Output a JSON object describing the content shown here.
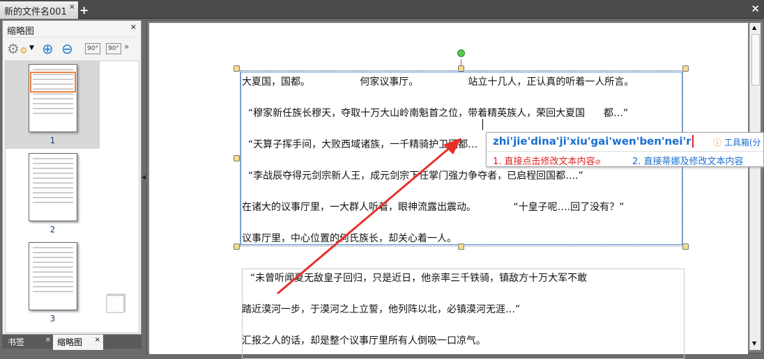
{
  "tabs": {
    "document": "新的文件名001",
    "close": "×",
    "add": "+",
    "close_all": "×"
  },
  "left_panel": {
    "title": "缩略图",
    "close": "×",
    "pages": [
      "1",
      "2",
      "3"
    ],
    "bottom_tabs": [
      {
        "label": "书签",
        "close": "×"
      },
      {
        "label": "缩略图",
        "close": "×"
      }
    ],
    "toolbar": {
      "rotate_left": "90°",
      "rotate_right": "90°"
    }
  },
  "document": {
    "box1_lines": [
      "大夏国，国都。                何家议事厅。                站立十几人，正认真的听着一人所言。",
      "  “穆家新任族长穆天，夺取十万大山岭南魁首之位，带着精英族人，荣回大夏国      都…”",
      "  “天算子挥手间，大败西域诸族，一千精骑护卫回都…",
      "  “李战辰夺得元剑宗新人王，成元剑宗下任掌门强力争夺者，已启程回国都….”",
      "在诸大的议事厅里，一大群人听着，眼神流露出震动。            “十皇子呢….回了没有？”",
      "议事厅里，中心位置的何氏族长，却关心着一人。"
    ],
    "box2_lines": [
      "  “未曾听闻夏无敌皇子回归，只是近日，他亲率三千铁骑，镇敌方十万大军不敢",
      "踏近漠河一步，于漠河之上立誓，他列阵以北，必镇漠河无涯…”",
      "汇报之人的话，却是整个议事厅里所有人倒吸一口凉气。"
    ]
  },
  "ime": {
    "composition": "zhi'jie'dina'ji'xiu'gai'wen'ben'nei'r",
    "toolbox": "工具箱(分",
    "candidates": [
      "1. 直接点击修改文本内容",
      "2. 直接蒂娜及修改文本内容"
    ]
  },
  "colors": {
    "accent": "#1a6fd0",
    "candidate_red": "#e02020",
    "arrow": "#e8302a"
  }
}
